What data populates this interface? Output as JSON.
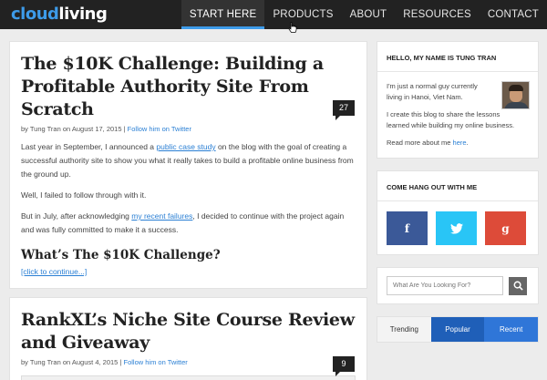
{
  "brand": {
    "part1": "cloud",
    "part2": "living"
  },
  "nav": {
    "items": [
      {
        "label": "START HERE",
        "active": true
      },
      {
        "label": "PRODUCTS",
        "active": false
      },
      {
        "label": "ABOUT",
        "active": false
      },
      {
        "label": "RESOURCES",
        "active": false
      },
      {
        "label": "CONTACT",
        "active": false
      }
    ]
  },
  "posts": [
    {
      "title": "The $10K Challenge: Building a Profitable Authority Site From Scratch",
      "author_prefix": "by Tung Tran",
      "date_text": "on August 17, 2015",
      "separator": "|",
      "twitter_link": "Follow him on Twitter",
      "comments": "27",
      "paragraphs": [
        {
          "before": "Last year in September, I announced a ",
          "link": "public case study",
          "after": " on the blog with the goal of creating a successful authority site to show you what it really takes to build a profitable online business from the ground up."
        },
        {
          "before": "Well, I failed to follow through with it.",
          "link": "",
          "after": ""
        },
        {
          "before": "But in July, after acknowledging ",
          "link": "my recent failures",
          "after": ", I decided to continue with the project again and was fully committed to make it a success."
        }
      ],
      "subheading": "What’s The $10K Challenge?",
      "continue": "[click to continue...]"
    },
    {
      "title": "RankXL’s Niche Site Course Review and Giveaway",
      "author_prefix": "by Tung Tran",
      "date_text": "on August 4, 2015",
      "separator": "|",
      "twitter_link": "Follow him on Twitter",
      "comments": "9"
    }
  ],
  "sidebar": {
    "about": {
      "title": "HELLO, MY NAME IS TUNG TRAN",
      "p1": "I'm just a normal guy currently living in Hanoi, Viet Nam.",
      "p2": "I create this blog to share the lessons learned while building my online business.",
      "p3_before": "Read more about me ",
      "p3_link": "here",
      "p3_after": "."
    },
    "social": {
      "title": "COME HANG OUT WITH ME",
      "buttons": [
        {
          "icon": "facebook-icon",
          "glyph": "f",
          "color": "#3b5998"
        },
        {
          "icon": "twitter-icon",
          "glyph": "🐦",
          "color": "#29c5f6"
        },
        {
          "icon": "google-plus-icon",
          "glyph": "g",
          "color": "#dd4b39"
        }
      ]
    },
    "search": {
      "placeholder": "What Are You Looking For?"
    },
    "tabs": {
      "trending": "Trending",
      "popular": "Popular",
      "recent": "Recent"
    }
  },
  "colors": {
    "accent": "#3d9be9",
    "link": "#2a7fd4",
    "topbar": "#222222"
  }
}
